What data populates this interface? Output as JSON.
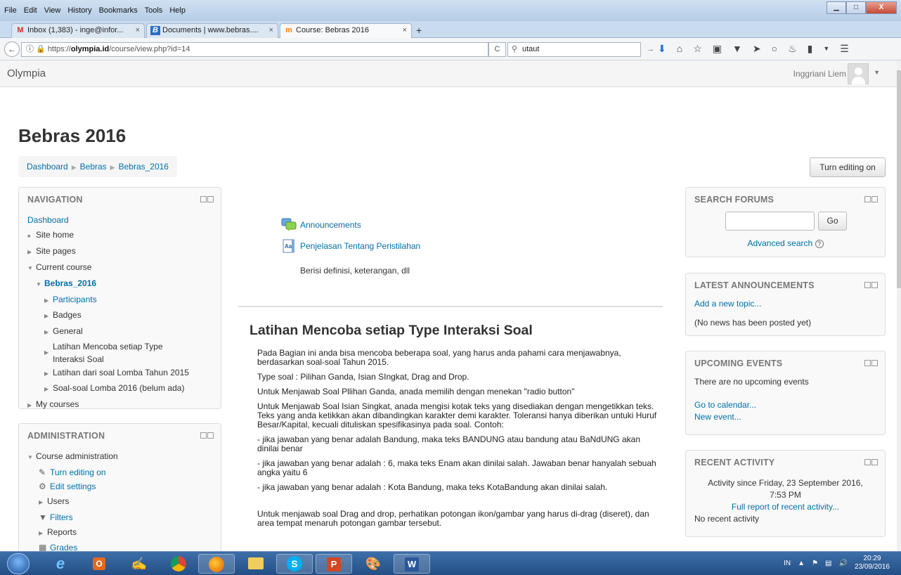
{
  "browser": {
    "menu": [
      "File",
      "Edit",
      "View",
      "History",
      "Bookmarks",
      "Tools",
      "Help"
    ],
    "tabs": [
      {
        "label": "Inbox (1,383) - inge@infor...",
        "icon": "M"
      },
      {
        "label": "Documents | www.bebras....",
        "icon": "B"
      },
      {
        "label": "Course: Bebras 2016",
        "icon": "m",
        "active": true
      }
    ],
    "tab_close": "×",
    "new_tab": "+",
    "url_prefix": "https://",
    "url_host": "olympia.id",
    "url_path": "/course/view.php?id=14",
    "search_value": "utaut",
    "back": "←",
    "reload": "C",
    "go_arrow": "→",
    "window_buttons": {
      "minimize": "▁",
      "maximize": "□",
      "close": "X"
    },
    "toolbar_icons": [
      "download-icon",
      "home-icon",
      "bookmark-star-icon",
      "reader-icon",
      "pocket-icon",
      "send-icon",
      "chat-icon",
      "extension-icon",
      "sidebar-icon",
      "dropdown-icon",
      "menu-icon"
    ]
  },
  "header": {
    "site_name": "Olympia",
    "user_name": "Inggriani Liem"
  },
  "page": {
    "title": "Bebras 2016",
    "breadcrumb": [
      "Dashboard",
      "Bebras",
      "Bebras_2016"
    ],
    "edit_button": "Turn editing on"
  },
  "navigation": {
    "title": "NAVIGATION",
    "items": [
      "Dashboard",
      "Site home",
      "Site pages",
      "Current course",
      "Bebras_2016",
      "Participants",
      "Badges",
      "General",
      "Latihan Mencoba setiap Type",
      "Interaksi Soal",
      "Latihan dari soal Lomba Tahun 2015",
      "Soal-soal Lomba 2016 (belum ada)",
      "My courses"
    ]
  },
  "administration": {
    "title": "ADMINISTRATION",
    "items": [
      "Course administration",
      "Turn editing on",
      "Edit settings",
      "Users",
      "Filters",
      "Reports",
      "Grades"
    ]
  },
  "main": {
    "activities": [
      "Announcements",
      "Penjelasan Tentang Peristilahan"
    ],
    "activity_desc": "Berisi definisi, keterangan, dll",
    "section_title": "Latihan Mencoba setiap Type Interaksi Soal",
    "paragraphs": [
      "Pada Bagian ini anda bisa mencoba beberapa soal, yang harus anda pahami cara menjawabnya, berdasarkan soal-soal Tahun 2015.",
      "Type soal : Pilihan Ganda, Isian SIngkat, Drag and Drop.",
      "Untuk Menjawab Soal Pllihan Ganda, anada memilih dengan menekan \"radio button\"",
      "Untuk Menjawab Soal Isian Singkat, anada mengisi kotak teks yang disediakan dengan mengetikkan teks. Teks yang anda ketikkan akan dibandingkan karakter demi karakter. Toleransi hanya diberikan untuki Huruf Besar/Kapital, kecuali dituliskan spesifikasinya pada soal. Contoh:",
      "- jika jawaban yang benar adalah Bandung, maka teks BANDUNG atau bandung atau BaNdUNG akan dinilai benar",
      "- jika jawaban yang benar adalah : 6, maka teks Enam akan dinilai salah. Jawaban benar hanyalah sebuah angka yaitu 6",
      "- jika jawaban yang benar adalah : Kota Bandung, maka teks KotaBandung akan dinilai salah.",
      "Untuk menjawab soal Drag and drop, perhatikan potongan ikon/gambar yang harus di-drag (diseret), dan area tempat menaruh potongan gambar tersebut."
    ]
  },
  "search_forums": {
    "title": "SEARCH FORUMS",
    "go": "Go",
    "advanced": "Advanced search"
  },
  "latest_announcements": {
    "title": "LATEST ANNOUNCEMENTS",
    "add": "Add a new topic...",
    "empty": "(No news has been posted yet)"
  },
  "upcoming_events": {
    "title": "UPCOMING EVENTS",
    "empty": "There are no upcoming events",
    "calendar": "Go to calendar...",
    "new_event": "New event..."
  },
  "recent_activity": {
    "title": "RECENT ACTIVITY",
    "since_line1": "Activity since Friday, 23 September 2016,",
    "since_line2": "7:53 PM",
    "full_report": "Full report of recent activity...",
    "empty": "No recent activity"
  },
  "taskbar": {
    "lang": "IN",
    "time": "20:29",
    "date": "23/09/2016"
  }
}
